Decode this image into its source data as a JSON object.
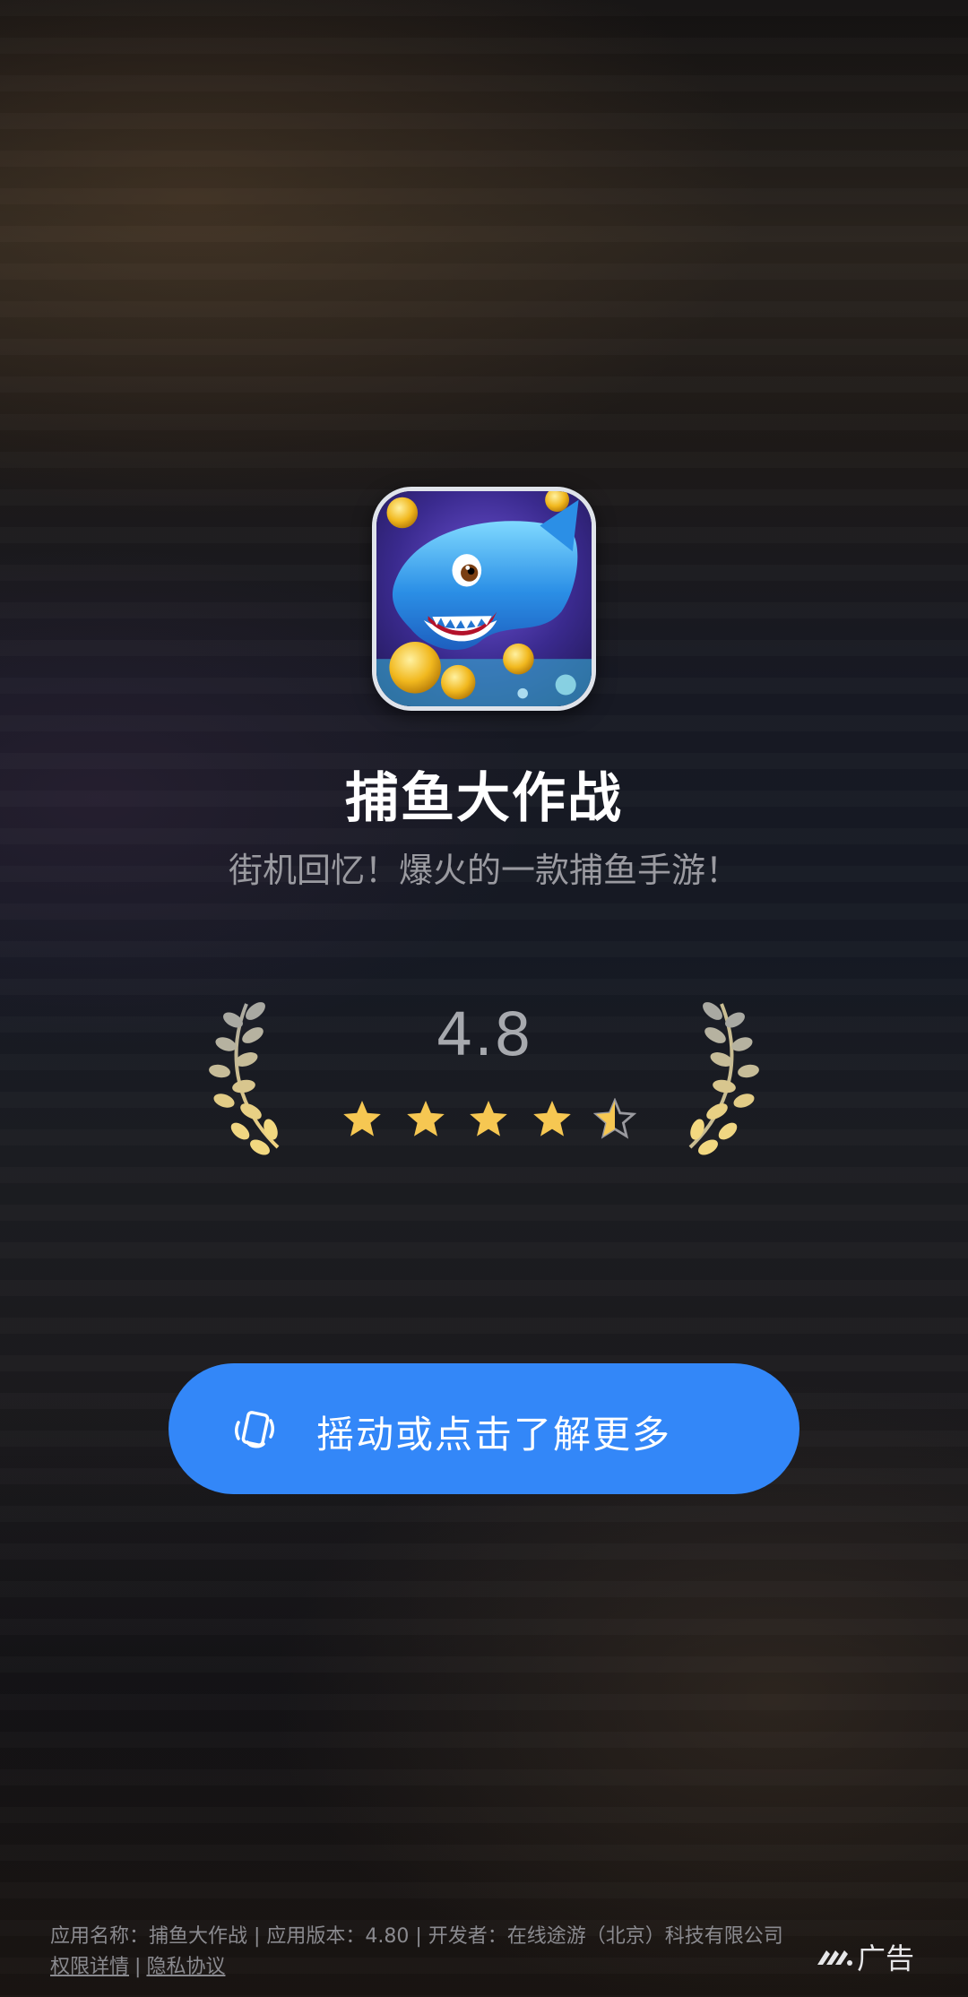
{
  "app": {
    "name": "捕鱼大作战",
    "subtitle": "街机回忆！爆火的一款捕鱼手游！",
    "icon": "shark-game-icon"
  },
  "rating": {
    "value": "4.8",
    "stars": 4.5,
    "star_color": "#f6c752"
  },
  "cta": {
    "label": "摇动或点击了解更多",
    "icon": "shake-phone-icon",
    "color": "#3387f8"
  },
  "footer": {
    "info": "应用名称：捕鱼大作战 | 应用版本：4.80 | 开发者：在线途游（北京）科技有限公司",
    "permissions_label": "权限详情",
    "separator": "|",
    "privacy_label": "隐私协议"
  },
  "ad_badge": {
    "label": "广告",
    "icon": "ad-logo-icon"
  }
}
